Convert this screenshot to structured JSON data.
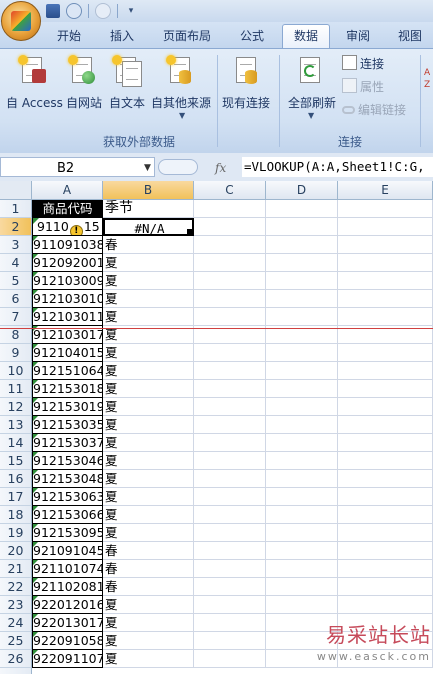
{
  "ribbon_tabs": [
    "开始",
    "插入",
    "页面布局",
    "公式",
    "数据",
    "审阅",
    "视图"
  ],
  "active_tab": "数据",
  "external_data_group": {
    "label": "获取外部数据",
    "buttons": [
      "自 Access",
      "自网站",
      "自文本",
      "自其他来源",
      "现有连接"
    ]
  },
  "connections_group": {
    "label": "连接",
    "refresh_all": "全部刷新",
    "connections": "连接",
    "properties": "属性",
    "edit_links": "编辑链接"
  },
  "name_box": "B2",
  "formula": "=VLOOKUP(A:A,Sheet1!C:G,",
  "fx_label": "fx",
  "columns": [
    "A",
    "B",
    "C",
    "D",
    "E"
  ],
  "selected_cell": {
    "column": "B",
    "row": 2
  },
  "rows": [
    {
      "row": "1",
      "a": "商品代码",
      "b": "季节"
    },
    {
      "row": "2",
      "a": "9110",
      "b": "#N/A",
      "a_suffix": "15"
    },
    {
      "row": "3",
      "a": "911091038",
      "b": "春"
    },
    {
      "row": "4",
      "a": "912092001",
      "b": "夏"
    },
    {
      "row": "5",
      "a": "912103009",
      "b": "夏"
    },
    {
      "row": "6",
      "a": "912103010",
      "b": "夏"
    },
    {
      "row": "7",
      "a": "912103011",
      "b": "夏"
    },
    {
      "row": "8",
      "a": "912103017",
      "b": "夏"
    },
    {
      "row": "9",
      "a": "912104015",
      "b": "夏"
    },
    {
      "row": "10",
      "a": "912151064",
      "b": "夏"
    },
    {
      "row": "11",
      "a": "912153018",
      "b": "夏"
    },
    {
      "row": "12",
      "a": "912153019",
      "b": "夏"
    },
    {
      "row": "13",
      "a": "912153035",
      "b": "夏"
    },
    {
      "row": "14",
      "a": "912153037",
      "b": "夏"
    },
    {
      "row": "15",
      "a": "912153046",
      "b": "夏"
    },
    {
      "row": "16",
      "a": "912153048",
      "b": "夏"
    },
    {
      "row": "17",
      "a": "912153063",
      "b": "夏"
    },
    {
      "row": "18",
      "a": "912153066",
      "b": "夏"
    },
    {
      "row": "19",
      "a": "912153095",
      "b": "夏"
    },
    {
      "row": "20",
      "a": "921091045",
      "b": "春"
    },
    {
      "row": "21",
      "a": "921101074",
      "b": "春"
    },
    {
      "row": "22",
      "a": "921102081",
      "b": "春"
    },
    {
      "row": "23",
      "a": "922012016",
      "b": "夏"
    },
    {
      "row": "24",
      "a": "922013017",
      "b": "夏"
    },
    {
      "row": "25",
      "a": "922091058",
      "b": "夏"
    },
    {
      "row": "26",
      "a": "922091107",
      "b": "夏"
    }
  ],
  "watermark": {
    "title": "易采站长站",
    "url": "www.easck.com"
  },
  "colors": {
    "accent": "#f1c15a",
    "header_fill": "#000000",
    "error_marker": "#f6c52d",
    "watermark": "#c64a5a"
  }
}
